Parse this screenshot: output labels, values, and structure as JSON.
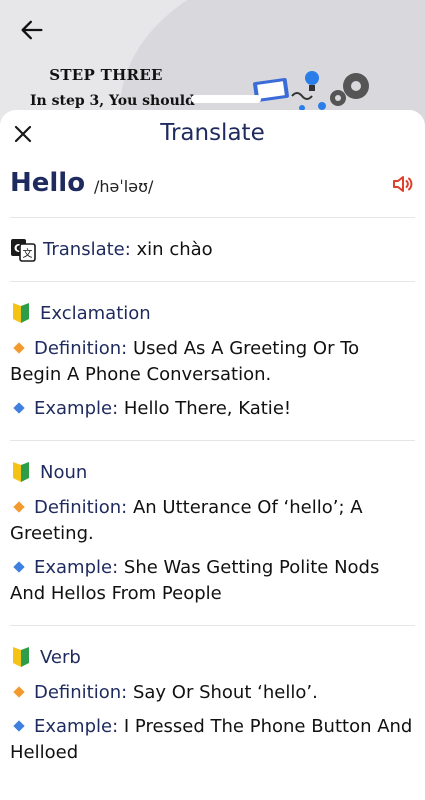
{
  "background": {
    "heading": "STEP THREE",
    "subtext": "In step 3, You should"
  },
  "sheet": {
    "title": "Translate",
    "word": "Hello",
    "phonetic": "/həˈləʊ/",
    "translate_label": "Translate:",
    "translate_value": "xin chào",
    "sections": [
      {
        "pos": "Exclamation",
        "definition_label": "Definition:",
        "definition": "Used As A Greeting Or To Begin A Phone Conversation.",
        "example_label": "Example:",
        "example": "Hello There, Katie!"
      },
      {
        "pos": "Noun",
        "definition_label": "Definition:",
        "definition": "An Utterance Of ‘hello’; A Greeting.",
        "example_label": "Example:",
        "example": "She Was Getting Polite Nods And Hellos From People"
      },
      {
        "pos": "Verb",
        "definition_label": "Definition:",
        "definition": "Say Or Shout ‘hello’.",
        "example_label": "Example:",
        "example": "I Pressed The Phone Button And Helloed"
      }
    ]
  },
  "icons": {
    "back": "arrow-left-icon",
    "close": "close-icon",
    "speaker": "speaker-icon",
    "translate": "google-translate-icon",
    "beginner": "beginner-mark-icon",
    "bullet_definition": "orange-diamond-icon",
    "bullet_example": "blue-diamond-icon"
  },
  "colors": {
    "accent": "#1f2a5e",
    "speaker": "#e0402b",
    "definition_bullet": "#f29a2e",
    "example_bullet": "#3f7fe0"
  }
}
